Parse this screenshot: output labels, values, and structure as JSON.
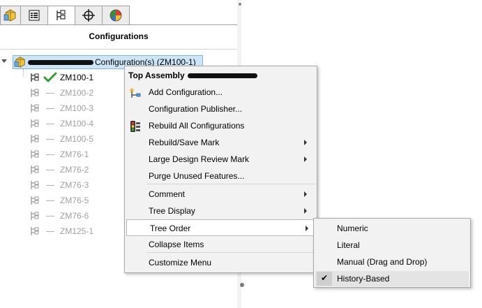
{
  "panel": {
    "title": "Configurations",
    "tabs": [
      {
        "icon": "feature-manager-icon"
      },
      {
        "icon": "property-manager-icon"
      },
      {
        "icon": "configuration-manager-icon"
      },
      {
        "icon": "dimxpert-manager-icon"
      },
      {
        "icon": "display-manager-icon"
      }
    ]
  },
  "tree": {
    "root_label": "Configuration(s)  (ZM100-1)",
    "items": [
      {
        "label": "ZM100-1",
        "active": true
      },
      {
        "label": "ZM100-2",
        "active": false
      },
      {
        "label": "ZM100-3",
        "active": false
      },
      {
        "label": "ZM100-4",
        "active": false
      },
      {
        "label": "ZM100-5",
        "active": false
      },
      {
        "label": "ZM76-1",
        "active": false
      },
      {
        "label": "ZM76-2",
        "active": false
      },
      {
        "label": "ZM76-3",
        "active": false
      },
      {
        "label": "ZM76-5",
        "active": false
      },
      {
        "label": "ZM76-6",
        "active": false
      },
      {
        "label": "ZM125-1",
        "active": false
      }
    ]
  },
  "context_menu": {
    "header": "Top Assembly",
    "items": [
      {
        "label": "Add Configuration...",
        "icon": "add-configuration-icon"
      },
      {
        "label": "Configuration Publisher..."
      },
      {
        "label": "Rebuild All Configurations",
        "icon": "rebuild-traffic-light-icon"
      },
      {
        "label": "Rebuild/Save Mark",
        "submenu": true
      },
      {
        "label": "Large Design Review Mark",
        "submenu": true
      },
      {
        "label": "Purge Unused Features..."
      },
      {
        "label": "Comment",
        "submenu": true
      },
      {
        "label": "Tree Display",
        "submenu": true
      },
      {
        "label": "Tree Order",
        "submenu": true,
        "highlighted": true
      },
      {
        "label": "Collapse Items"
      },
      {
        "label": "Customize Menu"
      }
    ]
  },
  "tree_order_submenu": {
    "items": [
      {
        "label": "Numeric",
        "checked": false
      },
      {
        "label": "Literal",
        "checked": false
      },
      {
        "label": "Manual (Drag and Drop)",
        "checked": false
      },
      {
        "label": "History-Based",
        "checked": true
      }
    ],
    "check_glyph": "✔"
  },
  "colors": {
    "selection_bg": "#cde6f7",
    "menu_bg": "#f2f2f2",
    "check_green": "#2e9e2e"
  }
}
